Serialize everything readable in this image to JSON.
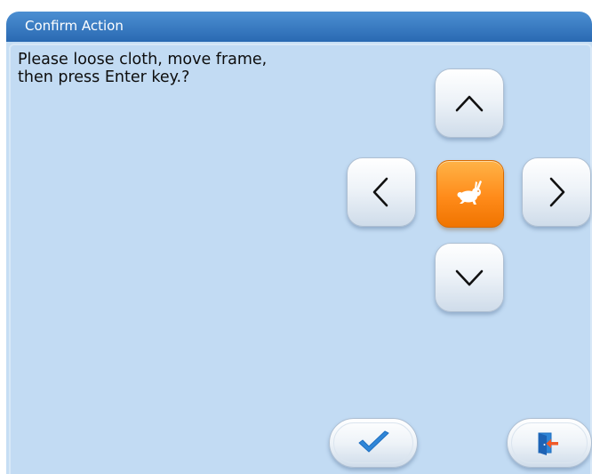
{
  "dialog": {
    "title": "Confirm Action",
    "message": "Please loose cloth, move frame, then press Enter key.?"
  },
  "controls": {
    "up": {
      "icon": "chevron-up-icon"
    },
    "left": {
      "icon": "chevron-left-icon"
    },
    "speed": {
      "icon": "rabbit-icon",
      "color": "#ff8b1a"
    },
    "right": {
      "icon": "chevron-right-icon"
    },
    "down": {
      "icon": "chevron-down-icon"
    }
  },
  "footer": {
    "confirm": {
      "icon": "checkmark-icon",
      "color": "#2f86d8"
    },
    "exit": {
      "icon": "exit-door-icon",
      "color": "#2f86d8",
      "accent": "#f05a28"
    }
  },
  "colors": {
    "titlebar": "#2a69b2",
    "panel": "#c2dbf3"
  }
}
